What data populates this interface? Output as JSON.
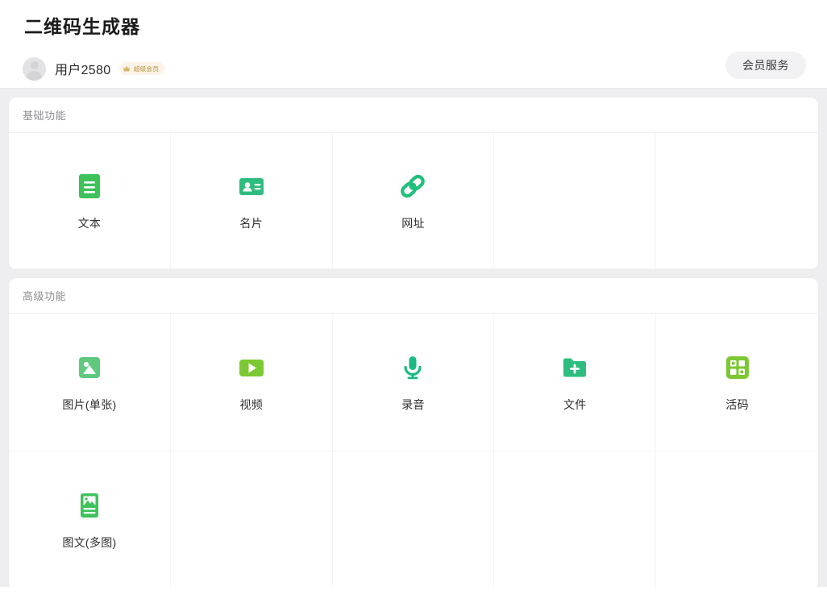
{
  "header": {
    "title": "二维码生成器",
    "avatar_icon": "user-avatar-placeholder",
    "username": "用户2580",
    "vip_badge": {
      "icon": "crown-icon",
      "label": "超级会员",
      "bg_color": "#fbf3e6",
      "text_color": "#b9913f"
    },
    "member_service_button": "会员服务"
  },
  "sections": [
    {
      "id": "basic",
      "title": "基础功能",
      "items": [
        {
          "label": "文本",
          "icon": "text-lines-icon",
          "color": "#3ec25a"
        },
        {
          "label": "名片",
          "icon": "contact-card-icon",
          "color": "#2ebd7e"
        },
        {
          "label": "网址",
          "icon": "link-chain-icon",
          "color": "#1fc07a"
        },
        {
          "label": "",
          "icon": "",
          "color": ""
        },
        {
          "label": "",
          "icon": "",
          "color": ""
        }
      ]
    },
    {
      "id": "advanced",
      "title": "高级功能",
      "items": [
        {
          "label": "图片(单张)",
          "icon": "image-picture-icon",
          "color": "#5fc97e"
        },
        {
          "label": "视频",
          "icon": "video-play-icon",
          "color": "#7cc832"
        },
        {
          "label": "录音",
          "icon": "microphone-icon",
          "color": "#1bb884"
        },
        {
          "label": "文件",
          "icon": "folder-plus-icon",
          "color": "#2ebd7e"
        },
        {
          "label": "活码",
          "icon": "qr-blocks-icon",
          "color": "#7cc832"
        },
        {
          "label": "图文(多图)",
          "icon": "image-text-doc-icon",
          "color": "#3ec25a"
        },
        {
          "label": "",
          "icon": "",
          "color": ""
        },
        {
          "label": "",
          "icon": "",
          "color": ""
        },
        {
          "label": "",
          "icon": "",
          "color": ""
        },
        {
          "label": "",
          "icon": "",
          "color": ""
        }
      ]
    }
  ],
  "theme": {
    "page_bg": "#eeeef0",
    "card_bg": "#ffffff",
    "accent_green": "#2ebd7e",
    "muted_text": "#8d8d92"
  }
}
